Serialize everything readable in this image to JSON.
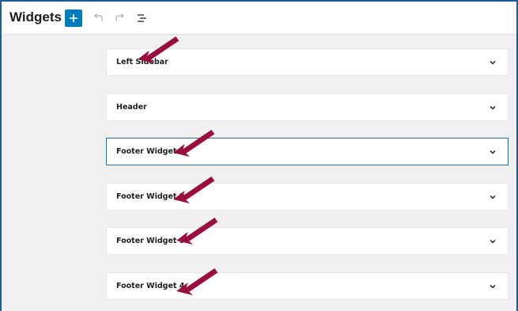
{
  "header": {
    "title": "Widgets",
    "add_icon": "plus-icon",
    "undo_icon": "undo-icon",
    "redo_icon": "redo-icon",
    "list_view_icon": "list-view-icon"
  },
  "colors": {
    "accent": "#007cba",
    "annotation_arrow": "#9b0d3c",
    "active_border": "#2c6e9b"
  },
  "widget_areas": [
    {
      "label": "Left Sidebar",
      "expanded": false
    },
    {
      "label": "Header",
      "expanded": false
    },
    {
      "label": "Footer Widget 1",
      "expanded": false,
      "focused": true
    },
    {
      "label": "Footer Widget 2",
      "expanded": false
    },
    {
      "label": "Footer Widget 3",
      "expanded": false
    },
    {
      "label": "Footer Widget 4",
      "expanded": false
    }
  ]
}
